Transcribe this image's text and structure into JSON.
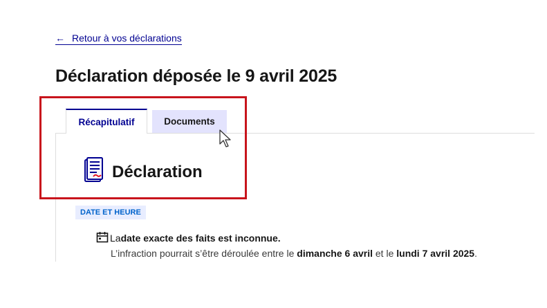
{
  "back_link": {
    "arrow": "←",
    "label": "Retour à vos déclarations"
  },
  "page_title": "Déclaration déposée le 9 avril 2025",
  "tabs": [
    {
      "label": "Récapitulatif",
      "selected": true
    },
    {
      "label": "Documents",
      "selected": false
    }
  ],
  "section": {
    "icon": "document-form-icon",
    "title": "Déclaration"
  },
  "date_section": {
    "badge": "DATE ET HEURE",
    "icon": "calendar-icon",
    "line1_prefix": "La ",
    "line1_bold": "date exacte des faits est inconnue.",
    "line2_prefix": "L’infraction pourrait s’être déroulée entre le ",
    "line2_date1": "dimanche 6 avril",
    "line2_mid": " et le ",
    "line2_date2": "lundi 7 avril 2025",
    "line2_suffix": "."
  },
  "colors": {
    "accent": "#000091",
    "highlight": "#c8141c",
    "tab_inactive_bg": "#e3e3fd",
    "badge_bg": "#e8edff",
    "badge_text": "#0063cb"
  }
}
